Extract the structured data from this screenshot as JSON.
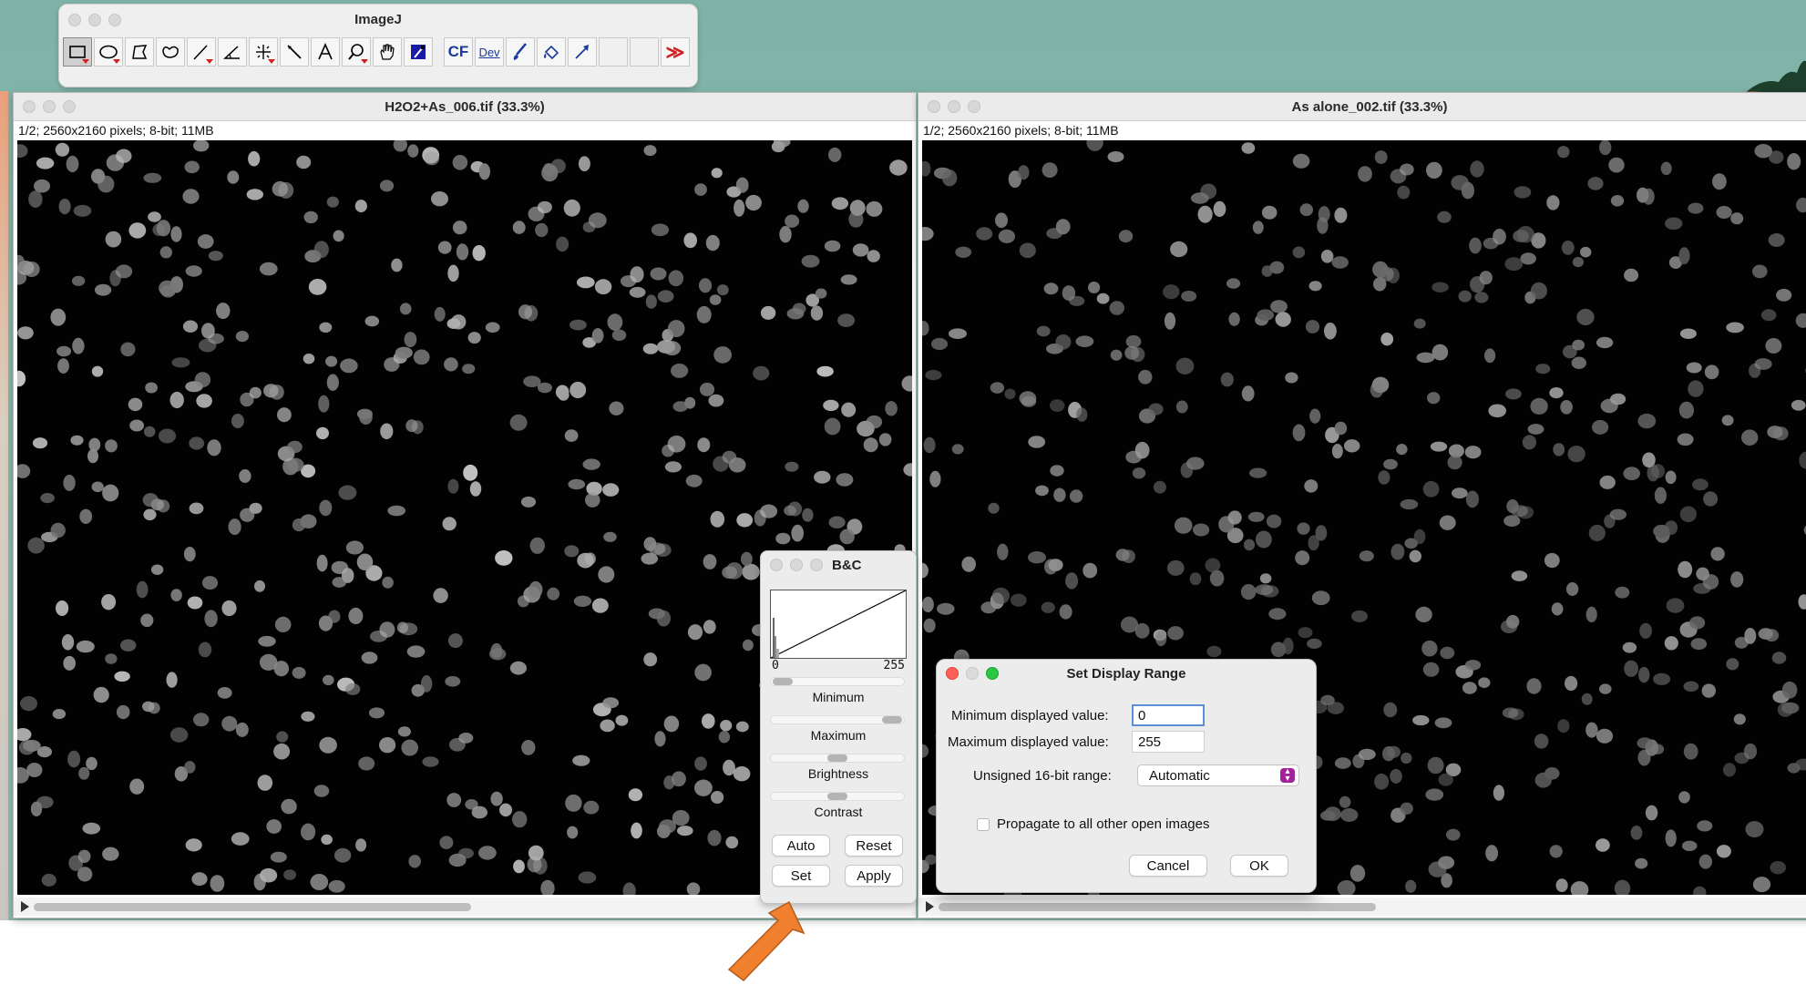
{
  "toolbar": {
    "title": "ImageJ",
    "cf_label": "CF",
    "dev_label": "Dev",
    "more_label": "≫"
  },
  "window_left": {
    "title": "H2O2+As_006.tif (33.3%)",
    "info": "1/2; 2560x2160 pixels; 8-bit; 11MB"
  },
  "window_right": {
    "title": "As alone_002.tif (33.3%)",
    "info": "1/2; 2560x2160 pixels; 8-bit; 11MB"
  },
  "bc": {
    "title": "B&C",
    "axis_min": "0",
    "axis_max": "255",
    "minimum_label": "Minimum",
    "maximum_label": "Maximum",
    "brightness_label": "Brightness",
    "contrast_label": "Contrast",
    "auto_label": "Auto",
    "reset_label": "Reset",
    "set_label": "Set",
    "apply_label": "Apply",
    "minimum_level": 0.0,
    "maximum_level": 1.0,
    "brightness_level": 0.5,
    "contrast_level": 0.5
  },
  "dialog": {
    "title": "Set Display Range",
    "min_label": "Minimum displayed value:",
    "min_value": "0",
    "max_label": "Maximum displayed value:",
    "max_value": "255",
    "range_label": "Unsigned 16-bit range:",
    "range_value": "Automatic",
    "propagate_label": "Propagate to all other open images",
    "propagate_checked": false,
    "cancel_label": "Cancel",
    "ok_label": "OK"
  },
  "colors": {
    "arrow": "#f07f2e",
    "desktop": "#86b8ad",
    "accent_purple": "#a3229b"
  }
}
